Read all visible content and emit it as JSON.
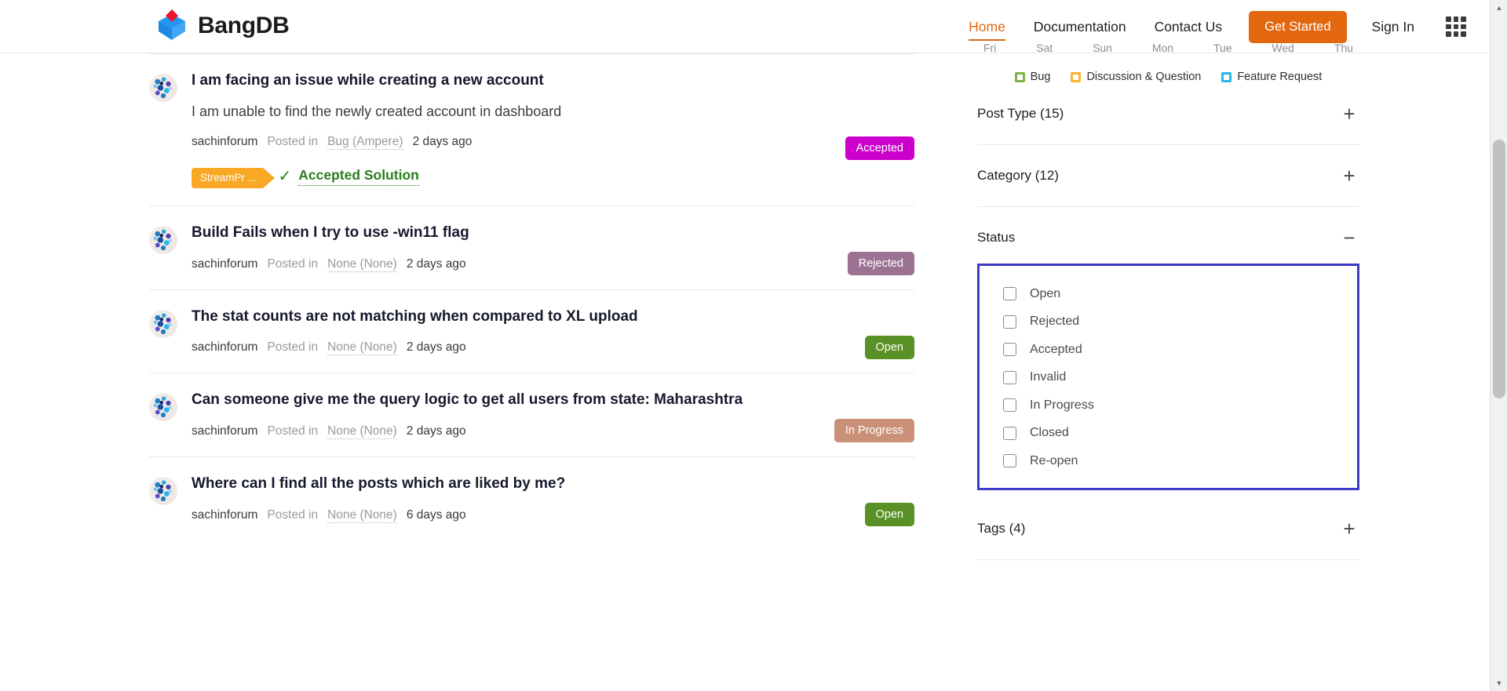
{
  "nav": {
    "brand": "BangDB",
    "links": [
      {
        "label": "Home",
        "active": true
      },
      {
        "label": "Documentation",
        "active": false
      },
      {
        "label": "Contact Us",
        "active": false
      }
    ],
    "get_started_label": "Get Started",
    "sign_in_label": "Sign In",
    "apps_icon": "apps-grid-icon",
    "accent_color": "#e2670f"
  },
  "posts": [
    {
      "title": "I am facing an issue while creating a new account",
      "description": "I am unable to find the newly created account in dashboard",
      "author": "sachinforum",
      "posted_in_label": "Posted in",
      "category": "Bug (Ampere)",
      "time": "2 days ago",
      "tag": "StreamPr ...",
      "accepted_solution_label": "Accepted Solution",
      "status": "Accepted",
      "status_color": "#cc00cc"
    },
    {
      "title": "Build Fails when I try to use -win11 flag",
      "description": "",
      "author": "sachinforum",
      "posted_in_label": "Posted in",
      "category": "None (None)",
      "time": "2 days ago",
      "tag": "",
      "accepted_solution_label": "",
      "status": "Rejected",
      "status_color": "#9c7293"
    },
    {
      "title": "The stat counts are not matching when compared to XL upload",
      "description": "",
      "author": "sachinforum",
      "posted_in_label": "Posted in",
      "category": "None (None)",
      "time": "2 days ago",
      "tag": "",
      "accepted_solution_label": "",
      "status": "Open",
      "status_color": "#5a9127"
    },
    {
      "title": "Can someone give me the query logic to get all users from state: Maharashtra",
      "description": "",
      "author": "sachinforum",
      "posted_in_label": "Posted in",
      "category": "None (None)",
      "time": "2 days ago",
      "tag": "",
      "accepted_solution_label": "",
      "status": "In Progress",
      "status_color": "#cb9178"
    },
    {
      "title": "Where can I find all the posts which are liked by me?",
      "description": "",
      "author": "sachinforum",
      "posted_in_label": "Posted in",
      "category": "None (None)",
      "time": "6 days ago",
      "tag": "",
      "accepted_solution_label": "",
      "status": "Open",
      "status_color": "#5a9127"
    }
  ],
  "sidebar": {
    "weekdays": [
      "Fri",
      "Sat",
      "Sun",
      "Mon",
      "Tue",
      "Wed",
      "Thu"
    ],
    "legend": [
      {
        "label": "Bug",
        "color": "#7cb342"
      },
      {
        "label": "Discussion & Question",
        "color": "#f9b233"
      },
      {
        "label": "Feature Request",
        "color": "#29b6e8"
      }
    ],
    "filters": [
      {
        "title": "Post Type (15)",
        "toggle": "+",
        "expanded": false
      },
      {
        "title": "Category (12)",
        "toggle": "+",
        "expanded": false
      },
      {
        "title": "Status",
        "toggle": "−",
        "expanded": true
      }
    ],
    "status_options": [
      {
        "label": "Open",
        "checked": false
      },
      {
        "label": "Rejected",
        "checked": false
      },
      {
        "label": "Accepted",
        "checked": false
      },
      {
        "label": "Invalid",
        "checked": false
      },
      {
        "label": "In Progress",
        "checked": false
      },
      {
        "label": "Closed",
        "checked": false
      },
      {
        "label": "Re-open",
        "checked": false
      }
    ],
    "tags_filter": {
      "title": "Tags (4)",
      "toggle": "+"
    },
    "highlight_color": "#3b3bc4"
  }
}
